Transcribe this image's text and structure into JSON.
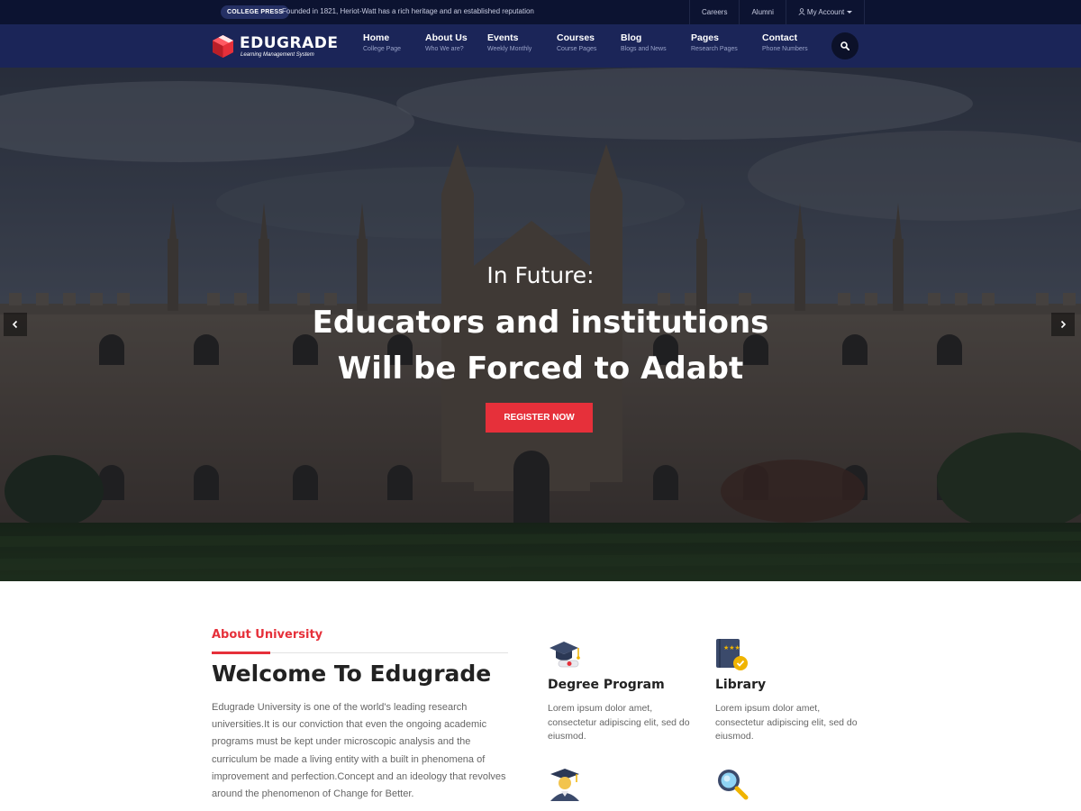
{
  "topbar": {
    "badge": "COLLEGE PRESS",
    "announcement": "Founded in 1821, Heriot-Watt has a rich heritage and an established reputation",
    "links": [
      "Careers",
      "Alumni"
    ],
    "account": "My Account"
  },
  "brand": {
    "name": "EDUGRADE",
    "tagline": "Learning Management System",
    "accent_color": "#e6303a",
    "nav_color": "#1b2558"
  },
  "nav": [
    {
      "label": "Home",
      "sub": "College Page"
    },
    {
      "label": "About Us",
      "sub": "Who We are?"
    },
    {
      "label": "Events",
      "sub": "Weekly Monthly"
    },
    {
      "label": "Courses",
      "sub": "Course Pages"
    },
    {
      "label": "Blog",
      "sub": "Blogs and News"
    },
    {
      "label": "Pages",
      "sub": "Research Pages"
    },
    {
      "label": "Contact",
      "sub": "Phone Numbers"
    }
  ],
  "hero": {
    "subtitle": "In Future:",
    "title_line1": "Educators and institutions",
    "title_line2": "Will be Forced to Adabt",
    "cta": "REGISTER NOW"
  },
  "about": {
    "kicker": "About University",
    "heading": "Welcome To Edugrade",
    "body": "Edugrade University is one of the world's leading research universities.It is our conviction that even the ongoing academic programs must be kept under microscopic analysis and the curriculum be made a living entity with a built in phenomena of improvement and perfection.Concept and an ideology that revolves around the phenomenon of Change for Better."
  },
  "features": [
    {
      "icon": "graduation-cap-diploma-icon",
      "title": "Degree Program",
      "desc": "Lorem ipsum dolor amet, consectetur adipiscing elit, sed do eiusmod."
    },
    {
      "icon": "library-book-icon",
      "title": "Library",
      "desc": "Lorem ipsum dolor amet, consectetur adipiscing elit, sed do eiusmod."
    },
    {
      "icon": "graduate-student-icon",
      "title": "",
      "desc": ""
    },
    {
      "icon": "magnifier-search-icon",
      "title": "",
      "desc": ""
    }
  ]
}
